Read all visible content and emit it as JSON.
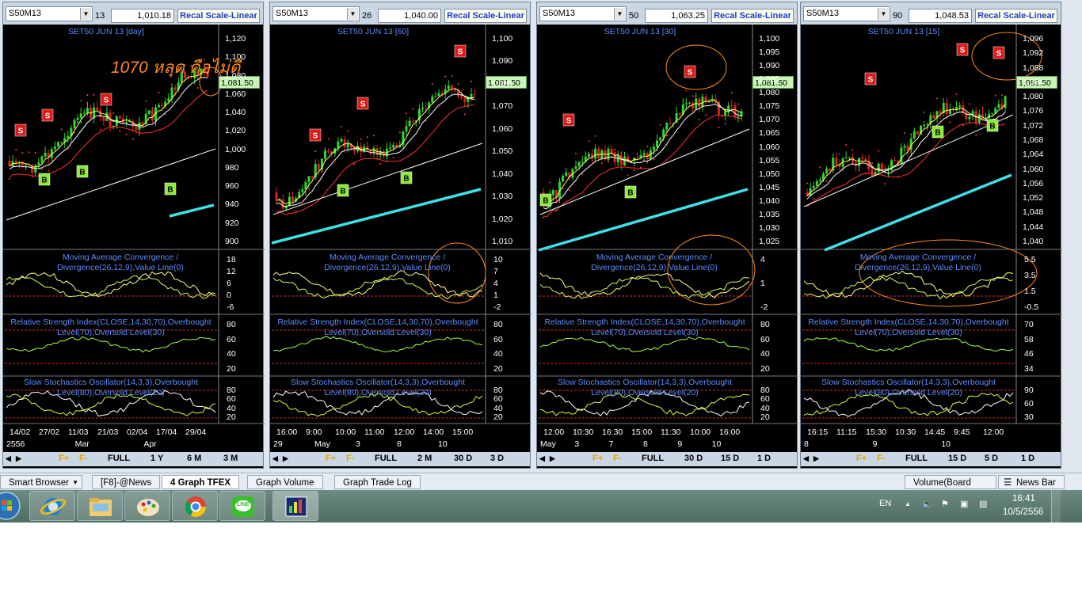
{
  "panels": [
    {
      "symbol": "S50M13",
      "param_tail": "13",
      "price": "1,010.18",
      "recal_label": "Recal Scale-Linear",
      "title": "SET50 JUN 13   [day]",
      "annotation": "1070 หลุด คือไม่ดี",
      "current_price": "1,081.50",
      "y_ticks": [
        "1,120",
        "1,100",
        "1,080",
        "1,060",
        "1,040",
        "1,020",
        "1,000",
        "980",
        "960",
        "940",
        "920",
        "900"
      ],
      "macd_ticks": [
        "18",
        "12",
        "6",
        "0",
        "-6"
      ],
      "rsi_ticks": [
        "80",
        "60",
        "40",
        "20"
      ],
      "stoch_ticks": [
        "80",
        "60",
        "40",
        "20"
      ],
      "x_ticks_top": [
        "14/02",
        "27/02",
        "11/03",
        "21/03",
        "02/04",
        "17/04",
        "29/04"
      ],
      "x_ticks_bottom": [
        "2556",
        "Mar",
        "Apr"
      ],
      "signals": [
        "S",
        "S",
        "S",
        "B",
        "B",
        "B"
      ],
      "ranges": [
        "FULL",
        "1 Y",
        "6 M",
        "3 M"
      ]
    },
    {
      "symbol": "S50M13",
      "param_tail": "26",
      "price": "1,040.00",
      "recal_label": "Recal Scale-Linear",
      "title": "SET50 JUN 13   [60]",
      "annotation": "",
      "current_price": "1,081.50",
      "y_ticks": [
        "1,100",
        "1,090",
        "1,080",
        "1,070",
        "1,060",
        "1,050",
        "1,040",
        "1,030",
        "1,020",
        "1,010"
      ],
      "macd_ticks": [
        "10",
        "7",
        "4",
        "1",
        "-2"
      ],
      "rsi_ticks": [
        "80",
        "60",
        "40",
        "20"
      ],
      "stoch_ticks": [
        "80",
        "60",
        "40",
        "20"
      ],
      "x_ticks_top": [
        "16:00",
        "9:00",
        "10:00",
        "11:00",
        "12:00",
        "14:00",
        "15:00"
      ],
      "x_ticks_bottom": [
        "29",
        "May",
        "3",
        "8",
        "10"
      ],
      "signals": [
        "S",
        "S",
        "S",
        "B",
        "B"
      ],
      "ranges": [
        "FULL",
        "2 M",
        "30 D",
        "3 D"
      ]
    },
    {
      "symbol": "S50M13",
      "param_tail": "50",
      "price": "1,063.25",
      "recal_label": "Recal Scale-Linear",
      "title": "SET50 JUN 13   [30]",
      "annotation": "",
      "current_price": "1,081.50",
      "y_ticks": [
        "1,100",
        "1,095",
        "1,090",
        "1,085",
        "1,080",
        "1,075",
        "1,070",
        "1,065",
        "1,060",
        "1,055",
        "1,050",
        "1,045",
        "1,040",
        "1,035",
        "1,030",
        "1,025"
      ],
      "macd_ticks": [
        "4",
        "1",
        "-2"
      ],
      "rsi_ticks": [
        "80",
        "60",
        "40",
        "20"
      ],
      "stoch_ticks": [
        "80",
        "60",
        "40",
        "20"
      ],
      "x_ticks_top": [
        "12:00",
        "10:30",
        "16:30",
        "15:00",
        "11:30",
        "10:00",
        "16:00"
      ],
      "x_ticks_bottom": [
        "May",
        "3",
        "7",
        "8",
        "9",
        "10"
      ],
      "signals": [
        "S",
        "S",
        "B",
        "B"
      ],
      "ranges": [
        "FULL",
        "30 D",
        "15 D",
        "1 D"
      ]
    },
    {
      "symbol": "S50M13",
      "param_tail": "90",
      "price": "1,048.53",
      "recal_label": "Recal Scale-Linear",
      "title": "SET50 JUN 13   [15]",
      "annotation": "",
      "current_price": "1,081.50",
      "y_ticks": [
        "1,096",
        "1,092",
        "1,088",
        "1,084",
        "1,080",
        "1,076",
        "1,072",
        "1,068",
        "1,064",
        "1,060",
        "1,056",
        "1,052",
        "1,048",
        "1,044",
        "1,040"
      ],
      "macd_ticks": [
        "5.5",
        "3.5",
        "1.5",
        "-0.5"
      ],
      "rsi_ticks": [
        "70",
        "58",
        "46",
        "34"
      ],
      "stoch_ticks": [
        "90",
        "60",
        "30"
      ],
      "x_ticks_top": [
        "16:15",
        "11:15",
        "15:30",
        "10:30",
        "14:45",
        "9:45",
        "12:00"
      ],
      "x_ticks_bottom": [
        "8",
        "9",
        "10"
      ],
      "signals": [
        "S",
        "S",
        "S",
        "B",
        "B"
      ],
      "ranges": [
        "FULL",
        "15 D",
        "5 D",
        "1 D"
      ]
    }
  ],
  "indicator_labels": {
    "macd": "Moving Average Convergence / Divergence(26,12,9),Value Line(0)",
    "rsi": "Relative Strength Index(CLOSE,14,30,70),Overbought Level(70),Oversold Level(30)",
    "stoch": "Slow Stochastics Oscillator(14,3,3),Overbought Level(80),Oversold Level(20)"
  },
  "fbuttons": {
    "fplus": "F+",
    "fminus": "F-"
  },
  "tabs": {
    "smart_browser": "Smart Browser",
    "items": [
      "[F8]-@News",
      "4 Graph TFEX",
      "Graph Volume",
      "Graph Trade Log"
    ],
    "volume": "Volume(Board Lot)",
    "news_bar": "News Bar"
  },
  "taskbar": {
    "lang": "EN",
    "time": "16:41",
    "date": "10/5/2556",
    "apps": [
      "internet-explorer",
      "file-explorer",
      "paint",
      "chrome",
      "line",
      "trading-app"
    ],
    "line_label": "LINE"
  },
  "colors": {
    "chart_bg": "#000000",
    "candle_up": "#2ed82e",
    "candle_down": "#e02020",
    "ma_fast": "#ffffff",
    "ma_mid": "#ffff66",
    "ma_slow": "#ff3030",
    "ma_long": "#3fe0e8",
    "axis_label": "#5a8cff",
    "sell_marker": "#e01818",
    "buy_marker": "#8ee83a",
    "annotation": "#ff8a1c"
  }
}
